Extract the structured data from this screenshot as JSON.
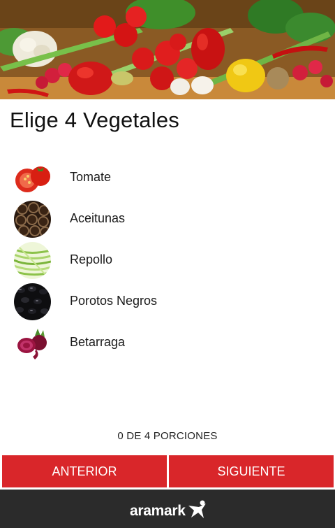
{
  "header": {
    "title": "Elige 4 Vegetales",
    "banner_icon": "vegetables-banner"
  },
  "vegetables": [
    {
      "label": "Tomate",
      "icon": "tomato-icon"
    },
    {
      "label": "Aceitunas",
      "icon": "olives-icon"
    },
    {
      "label": "Repollo",
      "icon": "cabbage-icon"
    },
    {
      "label": "Porotos Negros",
      "icon": "black-beans-icon"
    },
    {
      "label": "Betarraga",
      "icon": "beet-icon"
    }
  ],
  "counter": "0 DE 4 PORCIONES",
  "buttons": {
    "previous": "ANTERIOR",
    "next": "SIGUIENTE"
  },
  "footer": {
    "logo_text": "aramark"
  },
  "colors": {
    "accent": "#d9262a",
    "footer": "#2b2b2b"
  }
}
